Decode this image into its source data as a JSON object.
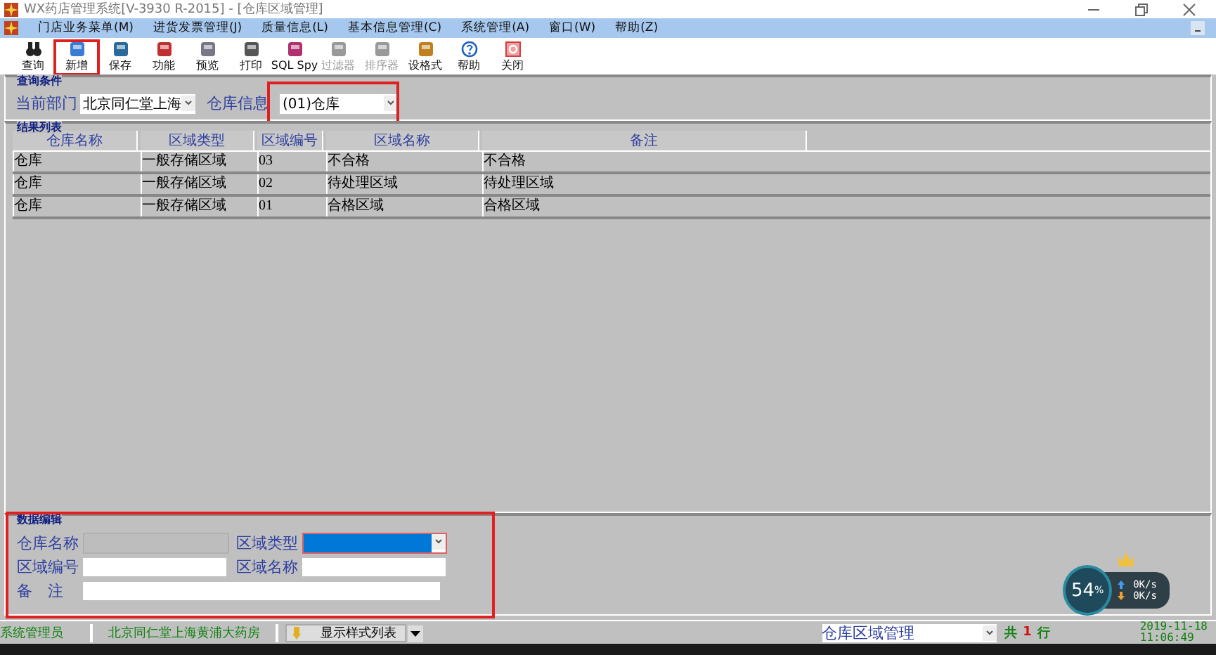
{
  "window": {
    "title": "WX药店管理系统[V-3930 R-2015] - [仓库区域管理]"
  },
  "menu": [
    "门店业务菜单(M)",
    "进货发票管理(J)",
    "质量信息(L)",
    "基本信息管理(C)",
    "系统管理(A)",
    "窗口(W)",
    "帮助(Z)"
  ],
  "toolbar": [
    {
      "label": "查询",
      "kind": "binoculars",
      "disabled": false,
      "highlighted": false
    },
    {
      "label": "新增",
      "kind": "add",
      "disabled": false,
      "highlighted": true
    },
    {
      "label": "保存",
      "kind": "save",
      "disabled": false,
      "highlighted": false
    },
    {
      "label": "功能",
      "kind": "function",
      "disabled": false,
      "highlighted": false
    },
    {
      "label": "预览",
      "kind": "preview",
      "disabled": false,
      "highlighted": false
    },
    {
      "label": "打印",
      "kind": "print",
      "disabled": false,
      "highlighted": false
    },
    {
      "label": "SQL Spy",
      "kind": "sql",
      "disabled": false,
      "highlighted": false
    },
    {
      "label": "过滤器",
      "kind": "filter",
      "disabled": true,
      "highlighted": false
    },
    {
      "label": "排序器",
      "kind": "sort",
      "disabled": true,
      "highlighted": false
    },
    {
      "label": "设格式",
      "kind": "format",
      "disabled": false,
      "highlighted": false
    },
    {
      "label": "帮助",
      "kind": "help",
      "disabled": false,
      "highlighted": false
    },
    {
      "label": "关闭",
      "kind": "close",
      "disabled": false,
      "highlighted": false
    }
  ],
  "query": {
    "title": "查询条件",
    "department_label": "当前部门",
    "department": "北京同仁堂上海",
    "warehouse_label": "仓库信息",
    "warehouse": "(01)仓库"
  },
  "results": {
    "title": "结果列表",
    "columns": [
      "仓库名称",
      "区域类型",
      "区域编号",
      "区域名称",
      "备注"
    ],
    "rows": [
      [
        "仓库",
        "一般存储区域",
        "03",
        "不合格",
        "不合格"
      ],
      [
        "仓库",
        "一般存储区域",
        "02",
        "待处理区域",
        "待处理区域"
      ],
      [
        "仓库",
        "一般存储区域",
        "01",
        "合格区域",
        "合格区域"
      ]
    ]
  },
  "edit": {
    "title": "数据编辑",
    "fields": [
      {
        "label": "仓库名称",
        "kind": "readonly"
      },
      {
        "label": "区域类型",
        "kind": "combo"
      },
      {
        "label": "区域编号",
        "kind": "text"
      },
      {
        "label": "区域名称",
        "kind": "text"
      },
      {
        "label": "备　注",
        "kind": "wide"
      }
    ]
  },
  "status_bar": {
    "user": "系统管理员",
    "store": "北京同仁堂上海黄浦大药房",
    "style_button": "显示样式列表",
    "module": "仓库区域管理",
    "count_a": "共",
    "count_b": "1",
    "count_c": "行",
    "date": "2019-11-18",
    "time": "11:06:49"
  },
  "net_widget": {
    "percent": "54",
    "percent_sign": "%",
    "upload": "0K/s",
    "download": "0K/s"
  }
}
